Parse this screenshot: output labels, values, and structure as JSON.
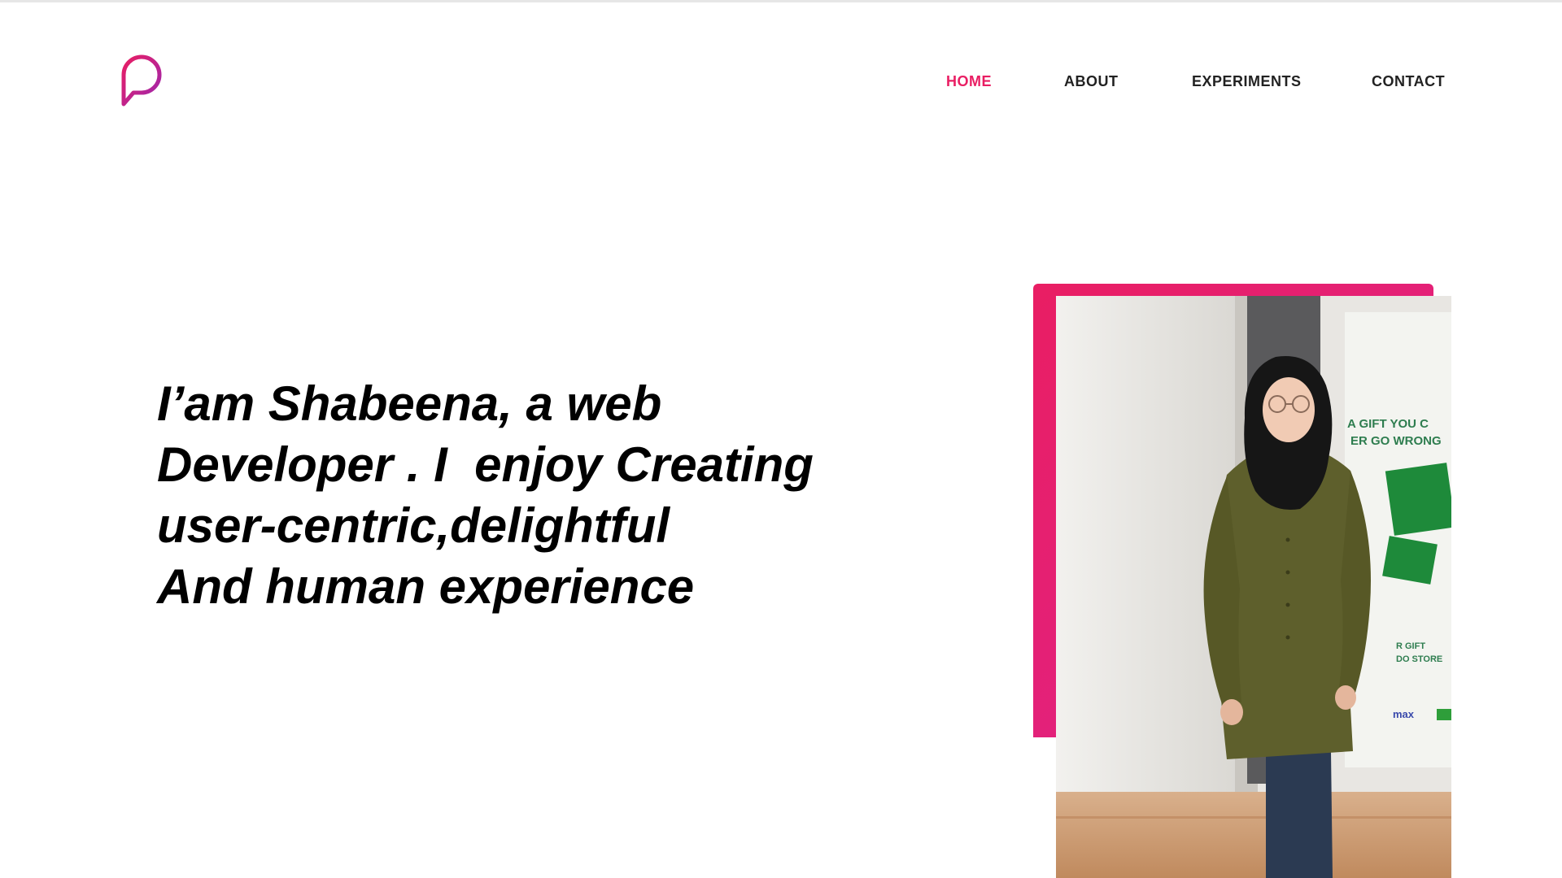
{
  "nav": {
    "items": [
      {
        "label": "HOME",
        "active": true
      },
      {
        "label": "ABOUT",
        "active": false
      },
      {
        "label": "EXPERIMENTS",
        "active": false
      },
      {
        "label": "CONTACT",
        "active": false
      }
    ]
  },
  "hero": {
    "lines": [
      "I’am Shabeena, a web",
      "Developer . I  enjoy Creating",
      "user-centric,delightful",
      "And human experience"
    ]
  },
  "photo": {
    "sign_lines": [
      "A GIFT YOU C",
      "ER GO WRONG",
      "R GIFT",
      "DO STORE"
    ],
    "brand": "max"
  },
  "icons": {
    "logo": "speech-bubble-p-logo"
  },
  "colors": {
    "accent": "#e91e63",
    "accent_purple": "#b81fb8",
    "text": "#000000",
    "nav_text": "#222222"
  }
}
